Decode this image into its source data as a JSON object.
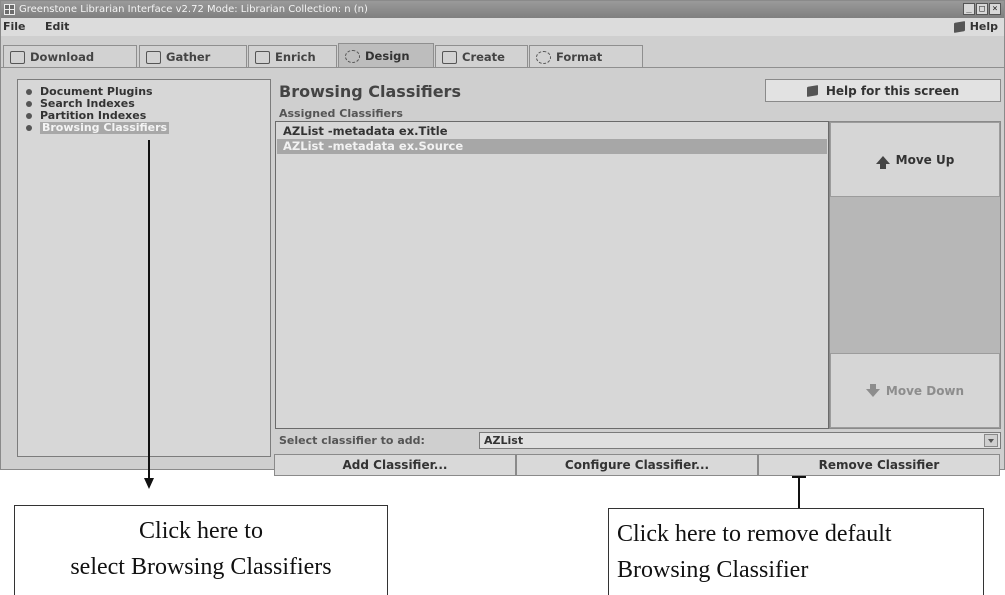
{
  "window": {
    "title": "Greenstone Librarian Interface v2.72  Mode: Librarian  Collection: n (n)",
    "controls": [
      "_",
      "□",
      "×"
    ]
  },
  "menu": {
    "file": "File",
    "edit": "Edit",
    "help": "Help"
  },
  "tabs": [
    {
      "label": "Download",
      "icon": "download-icon"
    },
    {
      "label": "Gather",
      "icon": "gather-icon"
    },
    {
      "label": "Enrich",
      "icon": "enrich-icon"
    },
    {
      "label": "Design",
      "icon": "design-icon",
      "active": true
    },
    {
      "label": "Create",
      "icon": "create-icon"
    },
    {
      "label": "Format",
      "icon": "format-icon"
    }
  ],
  "sidebar": {
    "items": [
      {
        "label": "Document Plugins"
      },
      {
        "label": "Search Indexes"
      },
      {
        "label": "Partition Indexes"
      },
      {
        "label": "Browsing Classifiers",
        "selected": true
      }
    ]
  },
  "main": {
    "title": "Browsing Classifiers",
    "help_button": "Help for this screen",
    "assigned_label": "Assigned Classifiers",
    "classifiers": [
      {
        "label": "AZList -metadata ex.Title"
      },
      {
        "label": "AZList -metadata ex.Source",
        "selected": true
      }
    ],
    "move_up": "Move Up",
    "move_down": "Move Down",
    "select_label": "Select classifier to add:",
    "select_value": "AZList",
    "add_button": "Add Classifier...",
    "configure_button": "Configure Classifier...",
    "remove_button": "Remove Classifier"
  },
  "callouts": {
    "left_line1": "Click here to",
    "left_line2": "select Browsing Classifiers",
    "right_line1": "Click here to remove default",
    "right_line2": "Browsing Classifier"
  }
}
